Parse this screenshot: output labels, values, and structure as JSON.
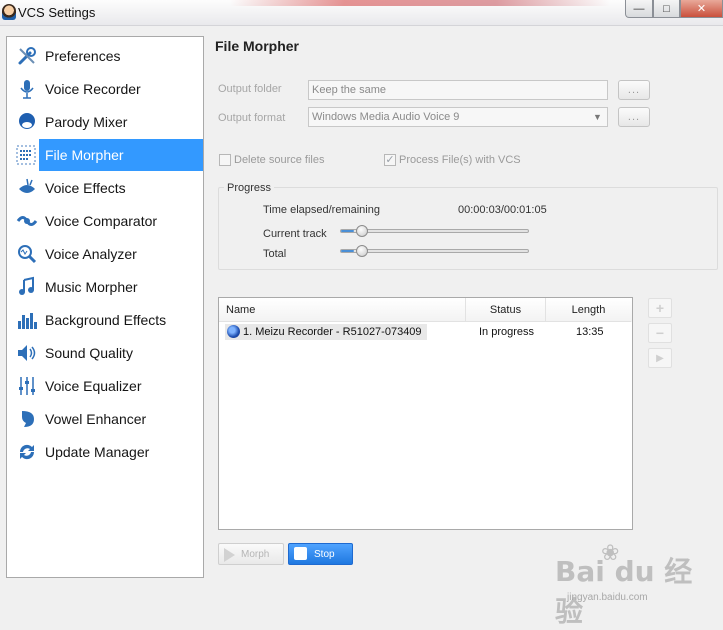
{
  "window": {
    "title": "VCS Settings",
    "controls": {
      "minimize": "—",
      "maximize": "□",
      "close": "✕"
    }
  },
  "sidebar": {
    "items": [
      {
        "label": "Preferences",
        "icon": "wrench-icon",
        "active": false
      },
      {
        "label": "Voice Recorder",
        "icon": "microphone-icon",
        "active": false
      },
      {
        "label": "Parody Mixer",
        "icon": "parody-face-icon",
        "active": false
      },
      {
        "label": "File Morpher",
        "icon": "file-morpher-icon",
        "active": true
      },
      {
        "label": "Voice Effects",
        "icon": "voice-effects-icon",
        "active": false
      },
      {
        "label": "Voice Comparator",
        "icon": "voice-comparator-icon",
        "active": false
      },
      {
        "label": "Voice Analyzer",
        "icon": "voice-analyzer-icon",
        "active": false
      },
      {
        "label": "Music Morpher",
        "icon": "music-note-icon",
        "active": false
      },
      {
        "label": "Background Effects",
        "icon": "equalizer-bars-icon",
        "active": false
      },
      {
        "label": "Sound Quality",
        "icon": "speaker-icon",
        "active": false
      },
      {
        "label": "Voice Equalizer",
        "icon": "equalizer-sliders-icon",
        "active": false
      },
      {
        "label": "Vowel Enhancer",
        "icon": "vowel-face-icon",
        "active": false
      },
      {
        "label": "Update Manager",
        "icon": "refresh-icon",
        "active": false
      }
    ]
  },
  "main": {
    "title": "File Morpher",
    "output_folder": {
      "label": "Output folder",
      "value": "Keep the same",
      "browse": "..."
    },
    "output_format": {
      "label": "Output format",
      "value": "Windows Media Audio Voice 9",
      "browse": "..."
    },
    "options": {
      "delete_source": {
        "label": "Delete source files",
        "checked": false
      },
      "process_with_vcs": {
        "label": "Process File(s) with VCS",
        "checked": true
      }
    },
    "progress": {
      "title": "Progress",
      "elapsed_label": "Time elapsed/remaining",
      "elapsed_value": "00:00:03/00:01:05",
      "current_track_label": "Current track",
      "current_track_fraction": 0.07,
      "total_label": "Total",
      "total_fraction": 0.07
    },
    "file_list": {
      "columns": [
        "Name",
        "Status",
        "Length"
      ],
      "rows": [
        {
          "name": "1. Meizu  Recorder - R51027-073409",
          "status": "In progress",
          "length": "13:35"
        }
      ]
    },
    "list_controls": {
      "add": "+",
      "remove": "−",
      "play": "▶"
    },
    "buttons": {
      "morph": "Morph",
      "stop": "Stop"
    }
  },
  "watermark": {
    "logo": "Bai du 经验",
    "sub": "jingyan.baidu.com"
  },
  "colors": {
    "selection": "#3399ff",
    "stop_button": "#1f78e0",
    "sidebar_bg": "#ffffff",
    "window_bg": "#f0f0f0"
  }
}
